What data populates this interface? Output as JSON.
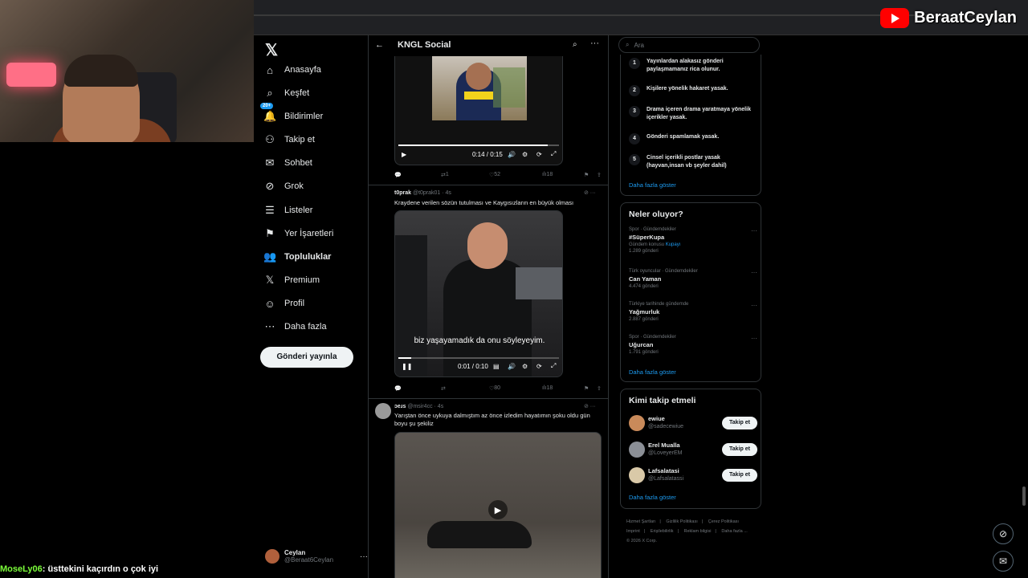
{
  "overlay": {
    "brand_name": "BeraatCeylan",
    "chat_user": "MoseLy06",
    "chat_message": ": üsttekini kaçırdın o çok iyi"
  },
  "nav": {
    "logo": "𝕏",
    "items": [
      {
        "label": "Anasayfa",
        "icon": "⌂"
      },
      {
        "label": "Keşfet",
        "icon": "⌕"
      },
      {
        "label": "Bildirimler",
        "icon": "🔔",
        "badge": "20+"
      },
      {
        "label": "Takip et",
        "icon": "⚇"
      },
      {
        "label": "Sohbet",
        "icon": "✉"
      },
      {
        "label": "Grok",
        "icon": "⊘"
      },
      {
        "label": "Listeler",
        "icon": "☰"
      },
      {
        "label": "Yer İşaretleri",
        "icon": "⚑"
      },
      {
        "label": "Topluluklar",
        "icon": "👥"
      },
      {
        "label": "Premium",
        "icon": "𝕏"
      },
      {
        "label": "Profil",
        "icon": "☺"
      },
      {
        "label": "Daha fazla",
        "icon": "⋯"
      }
    ],
    "post_button": "Gönderi yayınla",
    "account": {
      "name": "Ceylan",
      "handle": "@Beraat6Ceylan"
    }
  },
  "timeline": {
    "title": "KNGL Social",
    "tweets": [
      {
        "video_time": "0:14 / 0:15",
        "progress": 0.93,
        "retweets": "1",
        "likes": "52",
        "views": "18"
      },
      {
        "name": "t0prak",
        "handle": "@t0prak01 · 4s",
        "text": "Kraydene verilen sözün tutulması ve Kaygısızların en büyük olması",
        "caption": "biz yaşayamadık da onu söyleyeyim.",
        "video_time": "0:01 / 0:10",
        "progress": 0.08,
        "retweets": "",
        "likes": "80",
        "views": "18"
      },
      {
        "name": "ɔeɹs",
        "handle": "@msir4cc · 4s",
        "text": "Yarıştan önce uykuya dalmıştım az önce izledim hayatımın şoku oldu gün boyu şu şekiliz"
      }
    ]
  },
  "sidebar": {
    "search_placeholder": "Ara",
    "rules": [
      {
        "num": "1",
        "text": "Yayınlardan alakasız gönderi paylaşmamanız rica olunur."
      },
      {
        "num": "2",
        "text": "Kişilere yönelik hakaret yasak."
      },
      {
        "num": "3",
        "text": "Drama içeren drama yaratmaya yönelik içerikler yasak."
      },
      {
        "num": "4",
        "text": "Gönderi spamlamak yasak."
      },
      {
        "num": "5",
        "text": "Cinsel içerikli postlar yasak (hayvan,insan vb şeyler dahil)"
      }
    ],
    "show_more": "Daha fazla göster",
    "trends_title": "Neler oluyor?",
    "trends": [
      {
        "cat": "Spor · Gündemdekiler",
        "name": "#SüperKupa",
        "extra": "Gündem konusu",
        "extra_link": "Kupayı",
        "count": "1.289 gönderi"
      },
      {
        "cat": "Türk oyuncular · Gündemdekiler",
        "name": "Can Yaman",
        "extra": "",
        "extra_link": "",
        "count": "4.474 gönderi"
      },
      {
        "cat": "Türkiye tarihinde gündemde",
        "name": "Yağmurluk",
        "extra": "",
        "extra_link": "",
        "count": "2.887 gönderi"
      },
      {
        "cat": "Spor · Gündemdekiler",
        "name": "Uğurcan",
        "extra": "",
        "extra_link": "",
        "count": "1.791 gönderi"
      }
    ],
    "who_title": "Kimi takip etmeli",
    "who": [
      {
        "name": "ewiue",
        "handle": "@sadecewiue",
        "color": "#c98a5a"
      },
      {
        "name": "Erel Mualla",
        "handle": "@LoveyerEM",
        "color": "#8b8f96"
      },
      {
        "name": "Lafsalatasi",
        "handle": "@Lafsalatassi",
        "color": "#d9c9a8"
      }
    ],
    "follow_label": "Takip et",
    "footer": [
      "Hizmet Şartları",
      "|",
      "Gizlilik Politikası",
      "|",
      "Çerez Politikası",
      "|",
      "Imprint",
      "|",
      "Erişilebilirlik",
      "|",
      "Reklam bilgisi",
      "|",
      "Daha fazla ...",
      "© 2026 X Corp."
    ]
  },
  "colors": {
    "accent": "#1d9bf0",
    "youtube": "#ff0000",
    "chat_user": "#7cff3a"
  }
}
